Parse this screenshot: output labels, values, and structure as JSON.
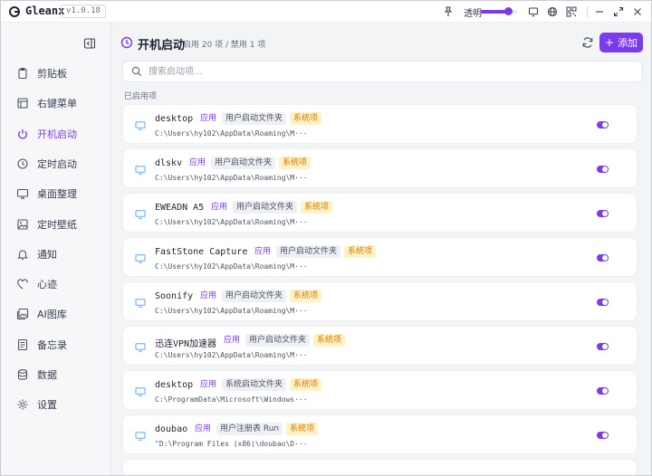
{
  "app": {
    "name": "Gleanx",
    "version": "v1.0.18",
    "opacity_label": "透明",
    "opacity_percent": 78,
    "accent": "#7c3aed"
  },
  "sidebar": {
    "items": [
      {
        "label": "剪贴板",
        "icon": "clipboard-icon"
      },
      {
        "label": "右键菜单",
        "icon": "context-menu-icon"
      },
      {
        "label": "开机启动",
        "icon": "power-icon",
        "active": true
      },
      {
        "label": "定时启动",
        "icon": "clock-icon"
      },
      {
        "label": "桌面整理",
        "icon": "desktop-icon"
      },
      {
        "label": "定时壁纸",
        "icon": "image-icon"
      },
      {
        "label": "通知",
        "icon": "bell-icon"
      },
      {
        "label": "心迹",
        "icon": "heart-icon"
      },
      {
        "label": "AI图库",
        "icon": "gallery-icon"
      },
      {
        "label": "备忘录",
        "icon": "memo-icon"
      },
      {
        "label": "数据",
        "icon": "database-icon"
      },
      {
        "label": "设置",
        "icon": "gear-icon"
      }
    ]
  },
  "header": {
    "title": "开机启动",
    "stats": "启用 20 项 / 禁用 1 项",
    "add_label": "添加"
  },
  "search": {
    "placeholder": "搜索启动项...",
    "value": ""
  },
  "section": {
    "enabled_label": "已启用项"
  },
  "entries": [
    {
      "name": "desktop",
      "tags": [
        "应用",
        "用户启动文件夹",
        "系统项"
      ],
      "path": "C:\\Users\\hy102\\AppData\\Roaming\\M···",
      "enabled": true
    },
    {
      "name": "dlskv",
      "tags": [
        "应用",
        "用户启动文件夹",
        "系统项"
      ],
      "path": "C:\\Users\\hy102\\AppData\\Roaming\\M···",
      "enabled": true
    },
    {
      "name": "EWEADN A5",
      "tags": [
        "应用",
        "用户启动文件夹",
        "系统项"
      ],
      "path": "C:\\Users\\hy102\\AppData\\Roaming\\M···",
      "enabled": true
    },
    {
      "name": "FastStone Capture",
      "tags": [
        "应用",
        "用户启动文件夹",
        "系统项"
      ],
      "path": "C:\\Users\\hy102\\AppData\\Roaming\\M···",
      "enabled": true
    },
    {
      "name": "Soonify",
      "tags": [
        "应用",
        "用户启动文件夹",
        "系统项"
      ],
      "path": "C:\\Users\\hy102\\AppData\\Roaming\\M···",
      "enabled": true
    },
    {
      "name": "迅连VPN加速器",
      "tags": [
        "应用",
        "用户启动文件夹",
        "系统项"
      ],
      "path": "C:\\Users\\hy102\\AppData\\Roaming\\M···",
      "enabled": true
    },
    {
      "name": "desktop",
      "tags": [
        "应用",
        "系统启动文件夹",
        "系统项"
      ],
      "path": "C:\\ProgramData\\Microsoft\\Windows···",
      "enabled": true
    },
    {
      "name": "doubao",
      "tags": [
        "应用",
        "用户注册表 Run",
        "系统项"
      ],
      "path": "\"D:\\Program Files (x86)\\doubao\\D···",
      "enabled": true
    }
  ]
}
